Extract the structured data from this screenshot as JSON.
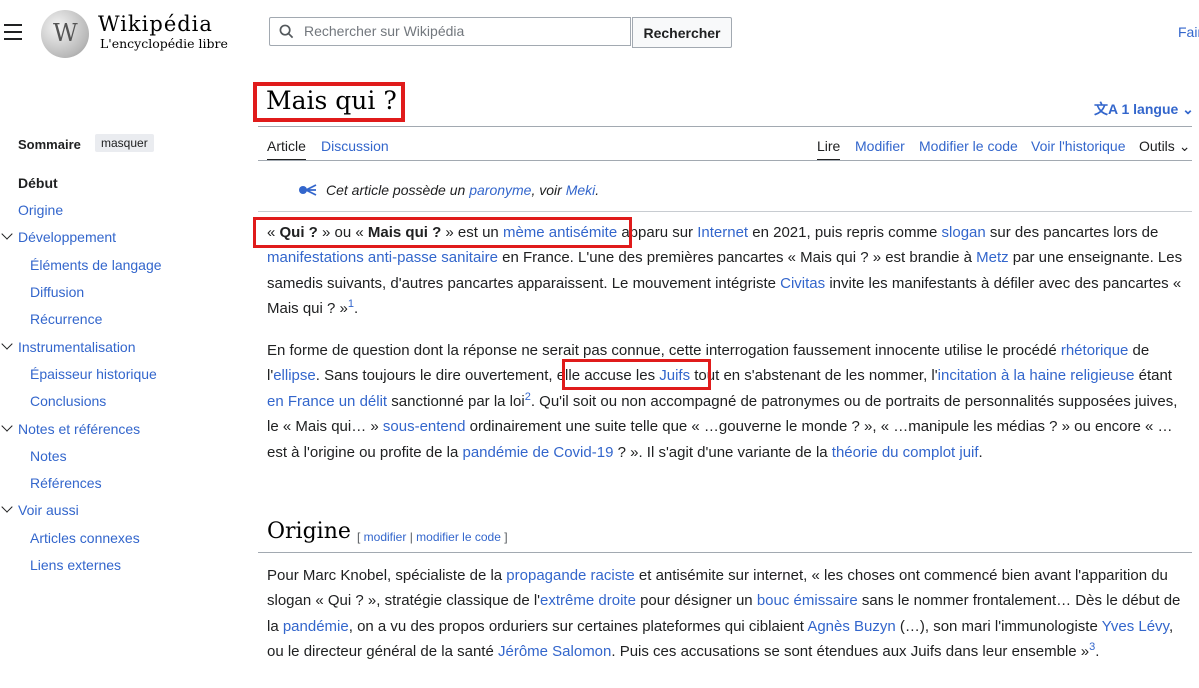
{
  "header": {
    "wordmark": "Wikipédia",
    "tagline": "L'encyclopédie libre",
    "search_placeholder": "Rechercher sur Wikipédia",
    "search_button": "Rechercher",
    "top_right_link": "Faire un don"
  },
  "toc": {
    "title": "Sommaire",
    "hide": "masquer",
    "items": [
      {
        "label": "Début"
      },
      {
        "label": "Origine"
      },
      {
        "label": "Développement"
      },
      {
        "label": "Éléments de langage"
      },
      {
        "label": "Diffusion"
      },
      {
        "label": "Récurrence"
      },
      {
        "label": "Instrumentalisation"
      },
      {
        "label": "Épaisseur historique"
      },
      {
        "label": "Conclusions"
      },
      {
        "label": "Notes et références"
      },
      {
        "label": "Notes"
      },
      {
        "label": "Références"
      },
      {
        "label": "Voir aussi"
      },
      {
        "label": "Articles connexes"
      },
      {
        "label": "Liens externes"
      }
    ]
  },
  "page": {
    "title": "Mais qui ?",
    "languages": "1 langue",
    "tabs": {
      "article": "Article",
      "discussion": "Discussion",
      "read": "Lire",
      "edit": "Modifier",
      "edit_source": "Modifier le code",
      "history": "Voir l'historique",
      "tools": "Outils"
    }
  },
  "hatnote": {
    "t1": "Cet article possède un ",
    "link1": "paronyme",
    "t2": ", voir ",
    "link2": "Meki",
    "t3": "."
  },
  "p1": {
    "a": "« ",
    "b": "Qui ?",
    "c": " » ou « ",
    "d": "Mais qui ?",
    "e": " » est un ",
    "f": "mème antisémite",
    "g": " apparu sur ",
    "h": "Internet",
    "i": " en 2021, puis repris comme ",
    "j": "slogan",
    "k": " sur des pancartes lors de ",
    "l": "manifestations anti-passe sanitaire",
    "m": " en France. L'une des premières pancartes « Mais qui ? » est brandie à ",
    "n": "Metz",
    "o": " par une enseignante. Les samedis suivants, d'autres pancartes apparaissent. Le mouvement intégriste ",
    "p": "Civitas",
    "q": " invite les manifestants à défiler avec des pancartes « Mais qui ? »",
    "r": "1",
    "s": "."
  },
  "p2": {
    "a": "En forme de question dont la réponse ne serait pas connue, cette interrogation faussement innocente utilise le procédé ",
    "b": "rhétorique",
    "c": " de l'",
    "d": "ellipse",
    "e": ". Sans toujours le dire ouvertement, elle accuse les ",
    "f": "Juifs",
    "g": " tout en s'abstenant de les nommer, l'",
    "h": "incitation à la haine religieuse",
    "i": " étant ",
    "j": "en France",
    "k": " ",
    "l": "un délit",
    "m": " sanctionné par la loi",
    "n": "2",
    "o": ". Qu'il soit ou non accompagné de patronymes ou de portraits de personnalités supposées juives, le « Mais qui… » ",
    "p": "sous-entend",
    "q": " ordinairement une suite telle que « …gouverne le monde ? », « …manipule les médias ? » ou encore « …est à l'origine ou profite de la ",
    "r": "pandémie de Covid-19",
    "s": " ? ». Il s'agit d'une variante de la ",
    "t": "théorie du complot juif",
    "u": "."
  },
  "section": {
    "title": "Origine",
    "open": "[ ",
    "edit": "modifier",
    "sep": " | ",
    "edit_source": "modifier le code",
    "close": " ]"
  },
  "p3": {
    "a": "Pour Marc Knobel, spécialiste de la ",
    "b": "propagande raciste",
    "c": " et antisémite sur internet, « les choses ont commencé bien avant l'apparition du slogan « Qui ? », stratégie classique de l'",
    "d": "extrême droite",
    "e": " pour désigner un ",
    "f": "bouc émissaire",
    "g": " sans le nommer frontalement… Dès le début de la ",
    "h": "pandémie",
    "i": ", on a vu des propos orduriers sur certaines plateformes qui ciblaient ",
    "j": "Agnès Buzyn",
    "k": " (…), son mari l'immunologiste ",
    "l": "Yves Lévy",
    "m": ", ou le directeur général de la santé ",
    "n": "Jérôme Salomon",
    "o": ". Puis ces accusations se sont étendues aux Juifs dans leur ensemble »",
    "p": "3",
    "q": "."
  },
  "colors": {
    "link": "#3366cc",
    "annotation": "#e01b1b"
  }
}
